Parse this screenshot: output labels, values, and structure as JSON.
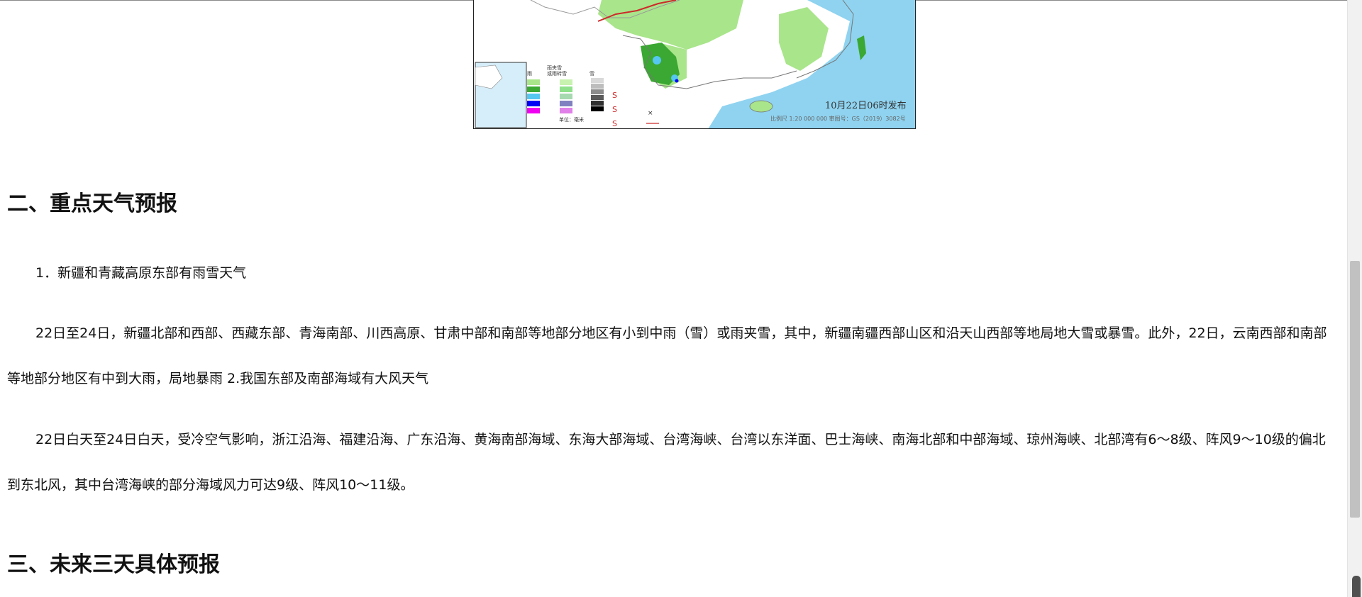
{
  "map": {
    "publish_date": "10月22日06时发布",
    "scale_text": "比例尺 1:20 000 000   审图号：GS（2019）3082号",
    "legend_unit": "单位：毫米",
    "legend": {
      "rain_title": "雨",
      "sleet_title": "雨夹雪 或雨转雪",
      "snow_title": "雪",
      "rain_colors": [
        "#a9e58b",
        "#3aa832",
        "#55c7f0",
        "#0000f5",
        "#f000f0"
      ],
      "sleet_colors": [
        "#c8f2b0",
        "#8fe08a",
        "#a7d9b0",
        "#8080c0",
        "#e080e8"
      ],
      "snow_colors": [
        "#d9d9d9",
        "#bdbdbd",
        "#8c8c8c",
        "#5a5a5a",
        "#303030",
        "#000000"
      ]
    }
  },
  "sections": {
    "sec2_title": "二、重点天气预报",
    "sec2_item1": "1．新疆和青藏高原东部有雨雪天气",
    "sec2_body1": "22日至24日，新疆北部和西部、西藏东部、青海南部、川西高原、甘肃中部和南部等地部分地区有小到中雨（雪）或雨夹雪，其中，新疆南疆西部山区和沿天山西部等地局地大雪或暴雪。此外，22日，云南西部和南部等地部分地区有中到大雨，局地暴雨 2.我国东部及南部海域有大风天气",
    "sec2_body2": "22日白天至24日白天，受冷空气影响，浙江沿海、福建沿海、广东沿海、黄海南部海域、东海大部海域、台湾海峡、台湾以东洋面、巴士海峡、南海北部和中部海域、琼州海峡、北部湾有6～8级、阵风9～10级的偏北到东北风，其中台湾海峡的部分海域风力可达9级、阵风10～11级。",
    "sec3_title": "三、未来三天具体预报"
  },
  "colors": {
    "sea": "#8fd3f0",
    "land_rain_light": "#a9e58b",
    "land_rain_mid": "#3aa832",
    "wind_line": "#cc2a2a"
  }
}
